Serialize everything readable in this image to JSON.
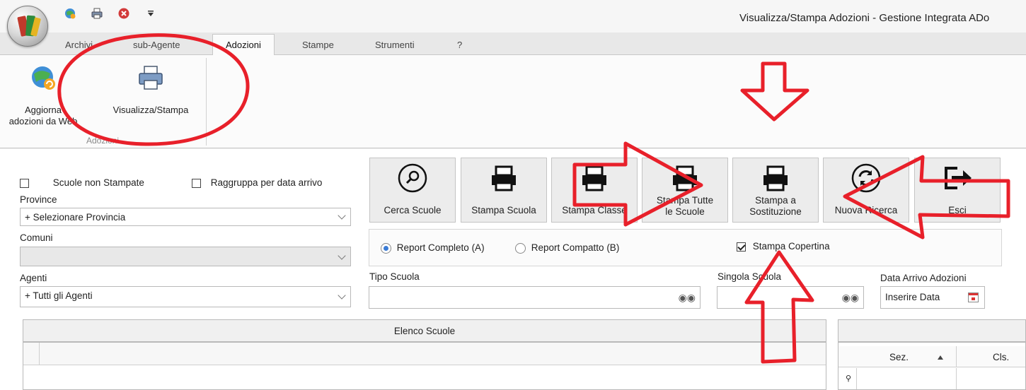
{
  "window": {
    "title": "Visualizza/Stampa Adozioni - Gestione Integrata ADo"
  },
  "quick_access": [
    {
      "icon": "globe-refresh-icon"
    },
    {
      "icon": "printer-icon"
    },
    {
      "icon": "close-circle-icon"
    },
    {
      "icon": "dropdown-arrow-icon"
    }
  ],
  "tabs": [
    {
      "label": "Archivi",
      "active": false
    },
    {
      "label": "sub-Agente",
      "active": false
    },
    {
      "label": "Adozioni",
      "active": true
    },
    {
      "label": "Stampe",
      "active": false
    },
    {
      "label": "Strumenti",
      "active": false
    },
    {
      "label": "?",
      "active": false
    }
  ],
  "ribbon": {
    "buttons": [
      {
        "label_line1": "Aggiorna",
        "label_line2": "adozioni da Web",
        "icon": "globe-refresh-icon"
      },
      {
        "label_line1": "Visualizza/Stampa",
        "label_line2": "",
        "icon": "printer-icon"
      }
    ],
    "group_label": "Adozioni"
  },
  "filters": {
    "scuole_non_stampate": {
      "label": "Scuole non Stampate",
      "checked": false
    },
    "raggruppa": {
      "label": "Raggruppa per data arrivo",
      "checked": false
    },
    "province": {
      "label": "Province",
      "value": "+ Selezionare Provincia"
    },
    "comuni": {
      "label": "Comuni",
      "value": ""
    },
    "agenti": {
      "label": "Agenti",
      "value": "+ Tutti gli Agenti"
    }
  },
  "toolbar": [
    {
      "line1": "Cerca Scuole",
      "line2": "",
      "icon": "search-icon"
    },
    {
      "line1": "Stampa Scuola",
      "line2": "",
      "icon": "printer-icon"
    },
    {
      "line1": "Stampa Classe",
      "line2": "",
      "icon": "printer-icon"
    },
    {
      "line1": "Stampa Tutte",
      "line2": "le Scuole",
      "icon": "printer-icon"
    },
    {
      "line1": "Stampa a",
      "line2": "Sostituzione",
      "icon": "printer-icon"
    },
    {
      "line1": "Nuova Ricerca",
      "line2": "",
      "icon": "refresh-icon"
    },
    {
      "line1": "Esci",
      "line2": "",
      "icon": "exit-icon"
    }
  ],
  "report_options": {
    "completo": {
      "label": "Report Completo (A)",
      "selected": true
    },
    "compatto": {
      "label": "Report Compatto (B)",
      "selected": false
    },
    "copertina": {
      "label": "Stampa Copertina",
      "checked": true
    }
  },
  "fields": {
    "tipo_scuola": {
      "label": "Tipo Scuola",
      "value": ""
    },
    "singola_scuola": {
      "label": "Singola Scuola",
      "value": ""
    },
    "data_arrivo": {
      "label": "Data Arrivo Adozioni",
      "placeholder": "Inserire Data"
    }
  },
  "grid_scuole": {
    "title": "Elenco Scuole"
  },
  "grid_classi": {
    "columns": [
      "Sez.",
      "Cls."
    ]
  },
  "colors": {
    "annotation": "#e8202a",
    "accent": "#3a7bd5"
  }
}
